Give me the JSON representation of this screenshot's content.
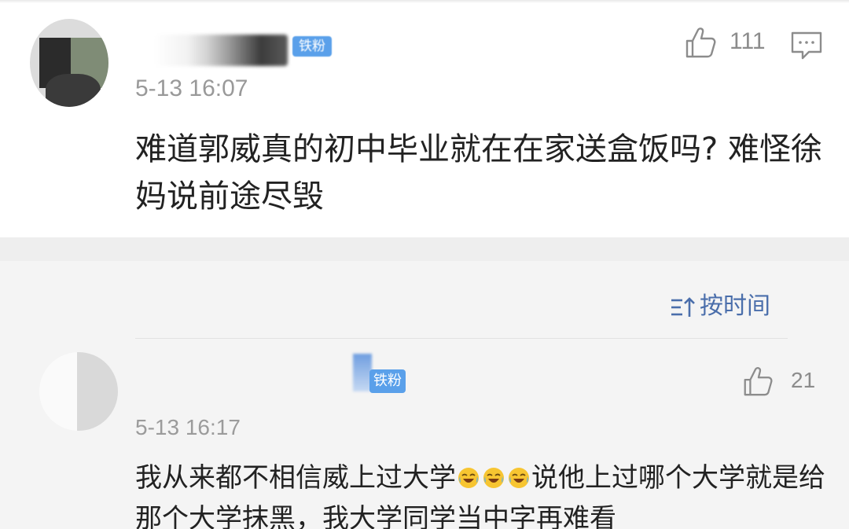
{
  "comment1": {
    "username": "",
    "badge": "铁粉",
    "time": "5-13 16:07",
    "likes": "111",
    "text": "难道郭威真的初中毕业就在在家送盒饭吗? 难怪徐妈说前途尽毁",
    "icons": [
      "avatar",
      "thumbs-up-icon",
      "reply-comment-icon"
    ]
  },
  "sort": {
    "label": "按时间",
    "icon": "sort-icon"
  },
  "comment2": {
    "username": "",
    "badge": "铁粉",
    "time": "5-13 16:17",
    "likes": "21",
    "text_before": "我从来都不相信威上过大学",
    "emoji_name": "laugh-cry-emoji",
    "text_after": "说他上过哪个大学就是给那个大学抹黑，我大学同学当中字再难看"
  },
  "colors": {
    "accent_blue": "#4a6eab",
    "badge_blue": "#5aa0ea",
    "text_dark": "#222222",
    "text_gray": "#999999",
    "background": "#f4f4f4"
  }
}
